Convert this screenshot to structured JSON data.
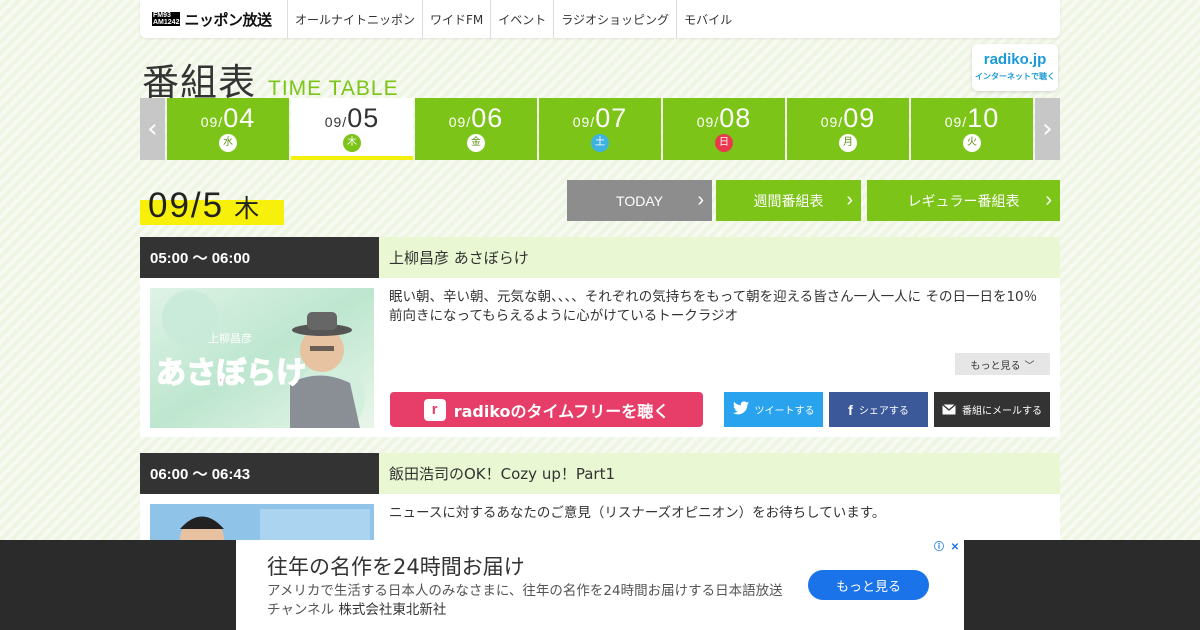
{
  "nav": {
    "logo_small_1": "FM93",
    "logo_small_2": "AM1242",
    "logo_name": "ニッポン放送",
    "items": [
      "オールナイトニッポン",
      "ワイドFM",
      "イベント",
      "ラジオショッピング",
      "モバイル"
    ]
  },
  "title": {
    "jp": "番組表",
    "en": "TIME TABLE"
  },
  "radiko_logo": {
    "name": "radiko.jp",
    "sub": "インターネットで聴く"
  },
  "dates": [
    {
      "month": "09/",
      "day": "04",
      "weekday": "水"
    },
    {
      "month": "09/",
      "day": "05",
      "weekday": "木"
    },
    {
      "month": "09/",
      "day": "06",
      "weekday": "金"
    },
    {
      "month": "09/",
      "day": "07",
      "weekday": "土"
    },
    {
      "month": "09/",
      "day": "08",
      "weekday": "日"
    },
    {
      "month": "09/",
      "day": "09",
      "weekday": "月"
    },
    {
      "month": "09/",
      "day": "10",
      "weekday": "火"
    }
  ],
  "current_date": {
    "date": "09/5",
    "weekday": "木"
  },
  "buttons": {
    "today": "TODAY",
    "weekly": "週間番組表",
    "regular": "レギュラー番組表"
  },
  "programs": [
    {
      "time": "05:00 ～ 06:00",
      "title": "上柳昌彦 あさぼらけ",
      "thumb_text": "あさぼらけ",
      "thumb_sub": "上柳昌彦",
      "desc": "眠い朝、辛い朝、元気な朝、、、、それぞれの気持ちをもって朝を迎える皆さん一人一人に その日一日を10％前向きになってもらえるように心がけているトークラジオ",
      "more": "もっと見る",
      "radiko": "radikoのタイムフリーを聴く",
      "tweet": "ツイートする",
      "share": "シェアする",
      "mail": "番組にメールする"
    },
    {
      "time": "06:00 ～ 06:43",
      "title": "飯田浩司のOK！Cozy up！Part1",
      "desc": "ニュースに対するあなたのご意見（リスナーズオピニオン）をお待ちしています。"
    }
  ],
  "ad": {
    "headline": "往年の名作を24時間お届け",
    "body": "アメリカで生活する日本人のみなさまに、往年の名作を24時間お届けする日本語放送チャンネル",
    "advertiser": "株式会社東北新社",
    "cta": "もっと見る"
  },
  "colors": {
    "green": "#7cc418",
    "yellow": "#f7f00a",
    "dark": "#333333",
    "radiko_pink": "#e63e68"
  }
}
